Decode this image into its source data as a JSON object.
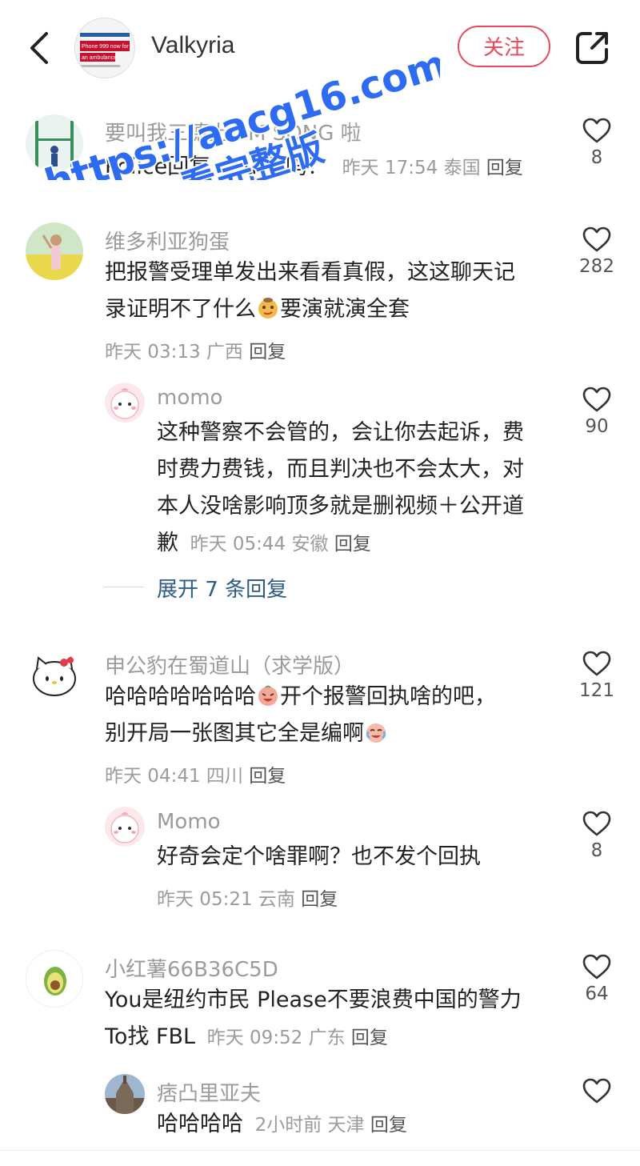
{
  "header": {
    "author_name": "Valkyria",
    "follow_label": "关注",
    "avatar_text_1": "Phone 999 now for",
    "avatar_text_2": "an ambulance"
  },
  "watermark": {
    "line1": "https://aacg16.com",
    "line2": "看完整版"
  },
  "comments": [
    {
      "username": "要叫我三德上 I'M SONG 啦",
      "text": "Police回复 you 了吗？",
      "time": "昨天 17:54",
      "location": "泰国",
      "reply_label": "回复",
      "likes": "8"
    },
    {
      "username": "维多利亚狗蛋",
      "text_line1": "把报警受理单发出来看看真假，这这聊天记",
      "text_line2a": "录证明不了什么",
      "text_line2b": "要演就演全套",
      "time": "昨天 03:13",
      "location": "广西",
      "reply_label": "回复",
      "likes": "282",
      "replies": [
        {
          "username": "momo",
          "text_line1": "这种警察不会管的，会让你去起诉，费",
          "text_line2": "时费力费钱，而且判决也不会太大，对",
          "text_line3": "本人没啥影响顶多就是删视频＋公开道",
          "text_line4": "歉",
          "time": "昨天 05:44",
          "location": "安徽",
          "reply_label": "回复",
          "likes": "90"
        }
      ],
      "expand_label": "展开 7 条回复"
    },
    {
      "username": "申公豹在蜀道山（求学版）",
      "text_line1a": "哈哈哈哈哈哈哈",
      "text_line1b": "开个报警回执啥的吧，",
      "text_line2a": "别开局一张图其它全是编啊",
      "time": "昨天 04:41",
      "location": "四川",
      "reply_label": "回复",
      "likes": "121",
      "replies": [
        {
          "username": "Momo",
          "text": "好奇会定个啥罪啊？也不发个回执",
          "time": "昨天 05:21",
          "location": "云南",
          "reply_label": "回复",
          "likes": "8"
        }
      ]
    },
    {
      "username": "小红薯66B36C5D",
      "text_line1": "You是纽约市民 Please不要浪费中国的警力",
      "text_line2": "To找 FBL",
      "time": "昨天 09:52",
      "location": "广东",
      "reply_label": "回复",
      "likes": "64",
      "replies": [
        {
          "username": "痞凸里亚夫",
          "text": "哈哈哈哈",
          "time": "2小时前",
          "location": "天津",
          "reply_label": "回复",
          "likes": ""
        }
      ]
    }
  ]
}
